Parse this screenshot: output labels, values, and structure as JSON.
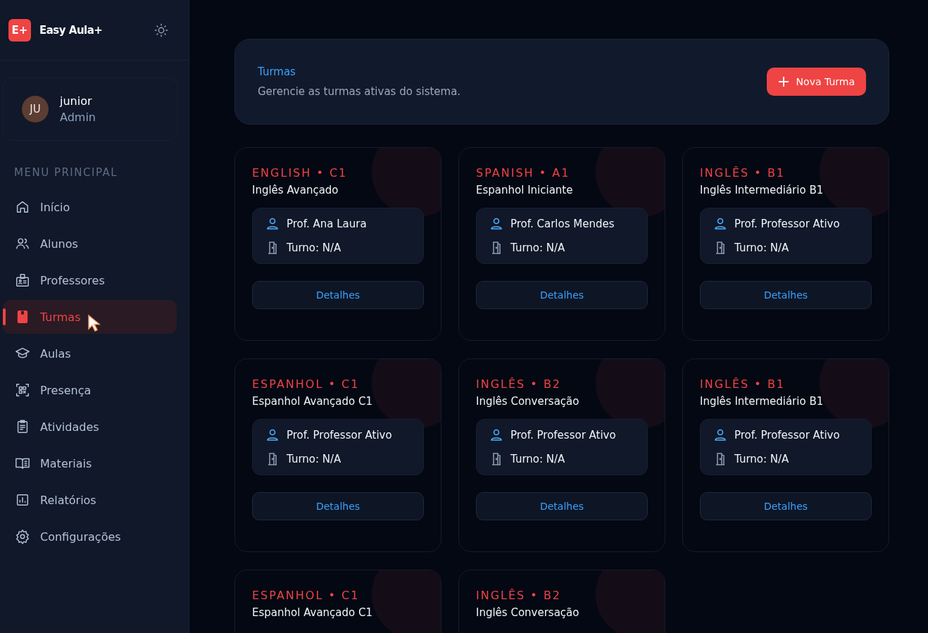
{
  "brand": {
    "logo": "E+",
    "name": "Easy Aula+"
  },
  "user": {
    "initials": "JU",
    "name": "junior",
    "role": "Admin"
  },
  "menu": {
    "heading": "MENU PRINCIPAL",
    "items": [
      {
        "label": "Início",
        "kind": "home",
        "selected": false
      },
      {
        "label": "Alunos",
        "kind": "users",
        "selected": false
      },
      {
        "label": "Professores",
        "kind": "badge",
        "selected": false
      },
      {
        "label": "Turmas",
        "kind": "book",
        "selected": true
      },
      {
        "label": "Aulas",
        "kind": "cap",
        "selected": false
      },
      {
        "label": "Presença",
        "kind": "qr",
        "selected": false
      },
      {
        "label": "Atividades",
        "kind": "clipboard",
        "selected": false
      },
      {
        "label": "Materiais",
        "kind": "open-book",
        "selected": false
      },
      {
        "label": "Relatórios",
        "kind": "chart",
        "selected": false
      },
      {
        "label": "Configurações",
        "kind": "gear",
        "selected": false
      }
    ]
  },
  "header": {
    "title": "Turmas",
    "subtitle": "Gerencie as turmas ativas do sistema.",
    "button_label": "Nova Turma"
  },
  "cards": [
    {
      "tag": "ENGLISH • C1",
      "title": "Inglês Avançado",
      "teacher": "Prof. Ana Laura",
      "shift": "Turno: N/A",
      "action": "Detalhes"
    },
    {
      "tag": "SPANISH • A1",
      "title": "Espanhol Iniciante",
      "teacher": "Prof. Carlos Mendes",
      "shift": "Turno: N/A",
      "action": "Detalhes"
    },
    {
      "tag": "INGLÊS • B1",
      "title": "Inglês Intermediário B1",
      "teacher": "Prof. Professor Ativo",
      "shift": "Turno: N/A",
      "action": "Detalhes"
    },
    {
      "tag": "ESPANHOL • C1",
      "title": "Espanhol Avançado C1",
      "teacher": "Prof. Professor Ativo",
      "shift": "Turno: N/A",
      "action": "Detalhes"
    },
    {
      "tag": "INGLÊS • B2",
      "title": "Inglês Conversação",
      "teacher": "Prof. Professor Ativo",
      "shift": "Turno: N/A",
      "action": "Detalhes"
    },
    {
      "tag": "INGLÊS • B1",
      "title": "Inglês Intermediário B1",
      "teacher": "Prof. Professor Ativo",
      "shift": "Turno: N/A",
      "action": "Detalhes"
    },
    {
      "tag": "ESPANHOL • C1",
      "title": "Espanhol Avançado C1"
    },
    {
      "tag": "INGLÊS • B2",
      "title": "Inglês Conversação"
    }
  ]
}
